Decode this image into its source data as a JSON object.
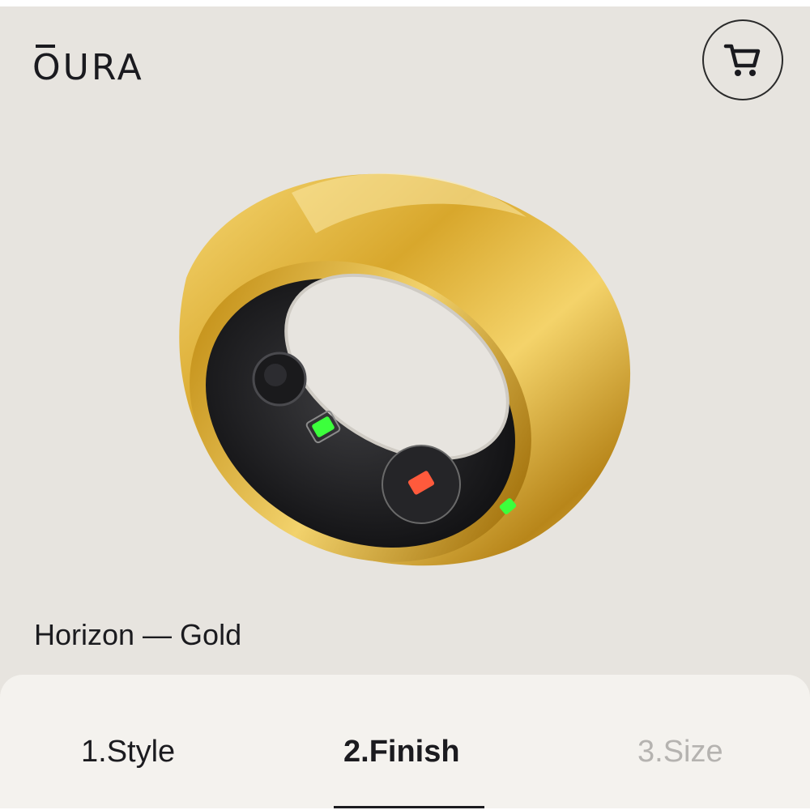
{
  "brand": {
    "logo_text": "OURA"
  },
  "header": {
    "cart_icon": "shopping-cart-icon"
  },
  "product": {
    "name": "Horizon — Gold",
    "image": "gold-smart-ring"
  },
  "steps": [
    {
      "label": "1.Style",
      "state": "completed"
    },
    {
      "label": "2.Finish",
      "state": "active"
    },
    {
      "label": "3.Size",
      "state": "disabled"
    }
  ],
  "colors": {
    "background": "#e7e4df",
    "panel": "#f4f2ee",
    "text": "#1b1b1f",
    "disabled_text": "#b5b3b0",
    "gold": "#d4a52a"
  }
}
